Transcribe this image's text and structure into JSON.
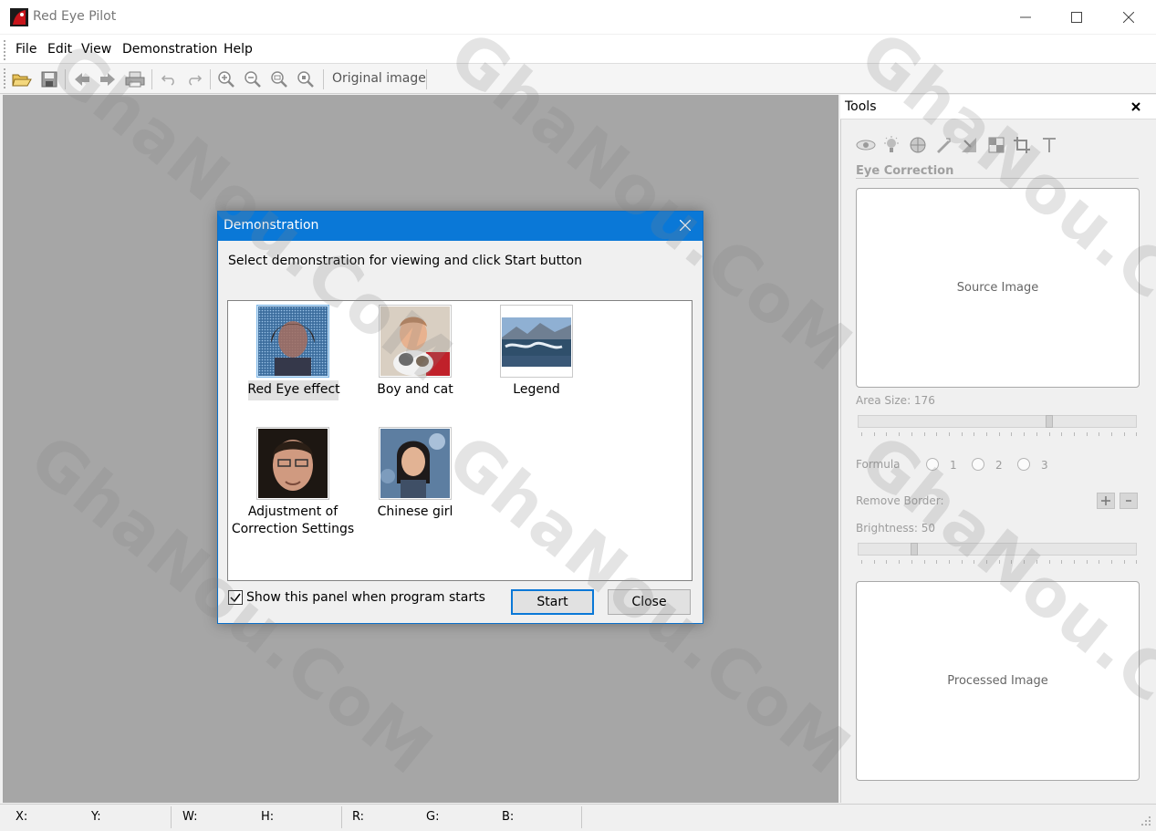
{
  "window": {
    "title": "Red Eye Pilot"
  },
  "menu": [
    "File",
    "Edit",
    "View",
    "Demonstration",
    "Help"
  ],
  "toolbar": {
    "original_image_label": "Original image"
  },
  "tools_panel": {
    "title": "Tools",
    "section_title": "Eye Correction",
    "source_image_label": "Source Image",
    "area_size_label": "Area Size: 176",
    "area_size_value": 176,
    "formula_label": "Formula",
    "formula_options": [
      "1",
      "2",
      "3"
    ],
    "remove_border_label": "Remove Border:",
    "brightness_label": "Brightness: 50",
    "brightness_value": 50,
    "processed_image_label": "Processed Image"
  },
  "dialog": {
    "title": "Demonstration",
    "instruction": "Select demonstration for viewing and click Start button",
    "items": [
      {
        "label": "Red Eye effect",
        "selected": true
      },
      {
        "label": "Boy and cat",
        "selected": false
      },
      {
        "label": "Legend",
        "selected": false
      },
      {
        "label_line1": "Adjustment of",
        "label_line2": "Correction Settings",
        "selected": false
      },
      {
        "label": "Chinese girl",
        "selected": false
      }
    ],
    "show_on_start_label": "Show this panel when program starts",
    "show_on_start_checked": true,
    "start_button": "Start",
    "close_button": "Close"
  },
  "statusbar": {
    "x": "X:",
    "y": "Y:",
    "w": "W:",
    "h": "H:",
    "r": "R:",
    "g": "G:",
    "b": "B:"
  },
  "watermark": "GhaNou.CoM",
  "colors": {
    "accent": "#0a78d7",
    "workspace": "#a6a6a6",
    "panel": "#f0f0f0"
  }
}
